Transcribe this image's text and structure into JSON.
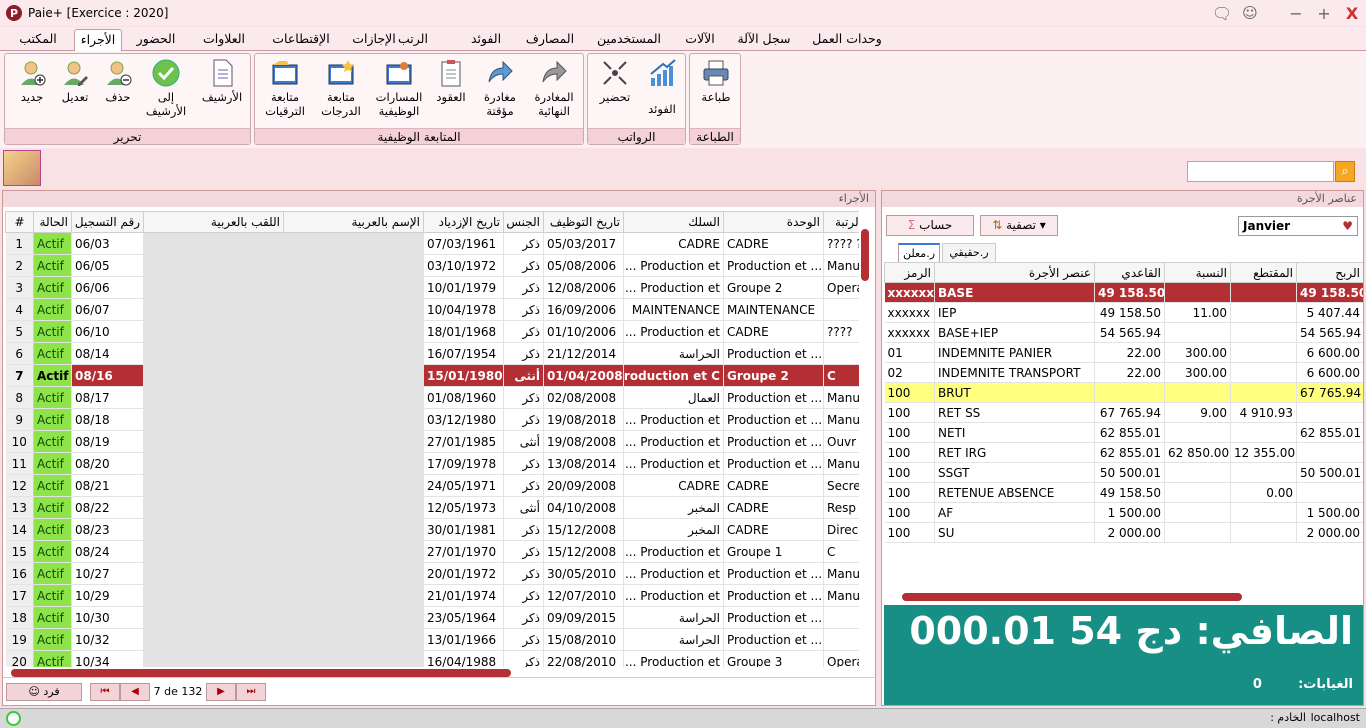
{
  "window": {
    "logo": "P",
    "title": "Paie+ [Exercice : 2020]",
    "close": "X",
    "maximize": "+",
    "minimize": "−"
  },
  "tabs": [
    "المكتب",
    "الأجراء",
    "الحضور",
    "العلاوات",
    "الإقتطاعات",
    "الإجازات",
    "الرتب",
    "الفوئد",
    "المصارف",
    "المستخدمين",
    "الآلات",
    "سجل الآلة",
    "وحدات العمل"
  ],
  "ribbon": {
    "edit_group": {
      "title": "تحرير",
      "new": "جديد",
      "edit": "تعديل",
      "delete": "حذف",
      "to_archive": "إلى الأرشيف",
      "archive": "الأرشيف"
    },
    "career_group": {
      "title": "المتابعة الوظيفية",
      "promotions": "متابعة الترقيات",
      "grades": "متابعة الدرجات",
      "career_paths": "المسارات الوظيفية",
      "contracts": "العقود",
      "temp_leave": "مغادرة مؤقتة",
      "final_leave": "المغادرة النهائية"
    },
    "payroll_group": {
      "title": "الرواتب",
      "prepare": "تحضير",
      "benefits": "الفوئد"
    },
    "print_group": {
      "title": "الطباعة",
      "print": "طباعة"
    }
  },
  "left_panel": {
    "title": "الأجراء",
    "columns": [
      "#",
      "الحالة",
      "رقم التسجيل",
      "اللقب بالعربية",
      "الإسم بالعربية",
      "تاريخ الإزدياد",
      "الجنس",
      "تاريخ التوظيف",
      "السلك",
      "الوحدة",
      "الرتبة"
    ],
    "rows": [
      [
        "1",
        "Actif",
        "06/03",
        "",
        "",
        "07/03/1961",
        "ذكر",
        "05/03/2017",
        "CADRE",
        "CADRE",
        "???? ?"
      ],
      [
        "2",
        "Actif",
        "06/05",
        "",
        "",
        "03/10/1972",
        "ذكر",
        "05/08/2006",
        "Production et ...",
        "Production et ...",
        "Manuf"
      ],
      [
        "3",
        "Actif",
        "06/06",
        "",
        "",
        "10/01/1979",
        "ذكر",
        "12/08/2006",
        "Production et ...",
        "Groupe 2",
        "Opera"
      ],
      [
        "4",
        "Actif",
        "06/07",
        "",
        "",
        "10/04/1978",
        "ذكر",
        "16/09/2006",
        "MAINTENANCE",
        "MAINTENANCE",
        ""
      ],
      [
        "5",
        "Actif",
        "06/10",
        "",
        "",
        "18/01/1968",
        "ذكر",
        "01/10/2006",
        "Production et ...",
        "CADRE",
        "????"
      ],
      [
        "6",
        "Actif",
        "08/14",
        "",
        "",
        "16/07/1954",
        "ذكر",
        "21/12/2014",
        "الحراسة",
        "Production et ...",
        ""
      ],
      [
        "7",
        "Actif",
        "08/16",
        "",
        "",
        "15/01/1980",
        "أنثى",
        "01/04/2008",
        "Production et C...",
        "Groupe 2",
        "C"
      ],
      [
        "8",
        "Actif",
        "08/17",
        "",
        "",
        "01/08/1960",
        "ذكر",
        "02/08/2008",
        "العمال",
        "Production et ...",
        "Manuf"
      ],
      [
        "9",
        "Actif",
        "08/18",
        "",
        "",
        "03/12/1980",
        "ذكر",
        "19/08/2018",
        "Production et ...",
        "Production et ...",
        "Manuf"
      ],
      [
        "10",
        "Actif",
        "08/19",
        "",
        "",
        "27/01/1985",
        "أنثى",
        "19/08/2008",
        "Production et ...",
        "Production et ...",
        "Ouvr"
      ],
      [
        "11",
        "Actif",
        "08/20",
        "",
        "",
        "17/09/1978",
        "ذكر",
        "13/08/2014",
        "Production et ...",
        "Production et ...",
        "Manuf"
      ],
      [
        "12",
        "Actif",
        "08/21",
        "",
        "",
        "24/05/1971",
        "ذكر",
        "20/09/2008",
        "CADRE",
        "CADRE",
        "Secre"
      ],
      [
        "13",
        "Actif",
        "08/22",
        "",
        "",
        "12/05/1973",
        "أنثى",
        "04/10/2008",
        "المخبر",
        "CADRE",
        "Resp"
      ],
      [
        "14",
        "Actif",
        "08/23",
        "",
        "",
        "30/01/1981",
        "ذكر",
        "15/12/2008",
        "المخبر",
        "CADRE",
        "Direc"
      ],
      [
        "15",
        "Actif",
        "08/24",
        "",
        "",
        "27/01/1970",
        "ذكر",
        "15/12/2008",
        "Production et ...",
        "Groupe 1",
        "C"
      ],
      [
        "16",
        "Actif",
        "10/27",
        "",
        "",
        "20/01/1972",
        "ذكر",
        "30/05/2010",
        "Production et ...",
        "Production et ...",
        "Manuf"
      ],
      [
        "17",
        "Actif",
        "10/29",
        "",
        "",
        "21/01/1974",
        "ذكر",
        "12/07/2010",
        "Production et ...",
        "Production et ...",
        "Manuf"
      ],
      [
        "18",
        "Actif",
        "10/30",
        "",
        "",
        "23/05/1964",
        "ذكر",
        "09/09/2015",
        "الحراسة",
        "Production et ...",
        ""
      ],
      [
        "19",
        "Actif",
        "10/32",
        "",
        "",
        "13/01/1966",
        "ذكر",
        "15/08/2010",
        "الحراسة",
        "Production et ...",
        ""
      ],
      [
        "20",
        "Actif",
        "10/34",
        "",
        "",
        "16/04/1988",
        "ذكر",
        "22/08/2010",
        "Production et ...",
        "Groupe 3",
        "Opera"
      ]
    ],
    "selected_row": 7,
    "single_button": "فرد",
    "pager": "7 de 132"
  },
  "right_panel": {
    "title": "عناصر الأجرة",
    "month": "Janvier",
    "calc_button": "حساب",
    "filter_button": "تصفية",
    "subtab_active": "ر.معلن",
    "subtab_other": "ر.حقيقي",
    "columns": [
      "الرمز",
      "عنصر الأجرة",
      "القاعدي",
      "النسبة",
      "المقتطع",
      "الربح"
    ],
    "rows": [
      [
        "xxxxxx",
        "BASE",
        "49 158.50",
        "",
        "",
        "49 158.50"
      ],
      [
        "xxxxxx",
        "IEP",
        "49 158.50",
        "11.00",
        "",
        "5 407.44"
      ],
      [
        "xxxxxx",
        "BASE+IEP",
        "54 565.94",
        "",
        "",
        "54 565.94"
      ],
      [
        "01",
        "INDEMNITE PANIER",
        "22.00",
        "300.00",
        "",
        "6 600.00"
      ],
      [
        "02",
        "INDEMNITE TRANSPORT",
        "22.00",
        "300.00",
        "",
        "6 600.00"
      ],
      [
        "100",
        "BRUT",
        "",
        "",
        "",
        "67 765.94"
      ],
      [
        "100",
        "RET SS",
        "67 765.94",
        "9.00",
        "4 910.93",
        ""
      ],
      [
        "100",
        "NETI",
        "62 855.01",
        "",
        "",
        "62 855.01"
      ],
      [
        "100",
        "RET IRG",
        "62 855.01",
        "62 850.00",
        "12 355.00",
        ""
      ],
      [
        "100",
        "SSGT",
        "50 500.01",
        "",
        "",
        "50 500.01"
      ],
      [
        "100",
        "RETENUE ABSENCE",
        "49 158.50",
        "",
        "0.00",
        ""
      ],
      [
        "100",
        "AF",
        "1 500.00",
        "",
        "",
        "1 500.00"
      ],
      [
        "100",
        "SU",
        "2 000.00",
        "",
        "",
        "2 000.00"
      ]
    ],
    "net_label": "الصافي:",
    "net_currency": "دج",
    "net_amount": "54 000.01",
    "absence_label": "الغيابات:",
    "absence_value": "0"
  },
  "statusbar": {
    "server_label": "الخادم :",
    "server": "localhost"
  },
  "colors": {
    "accent": "#b32f33",
    "net_bg": "#178f84",
    "status_active": "#8fe34a"
  }
}
